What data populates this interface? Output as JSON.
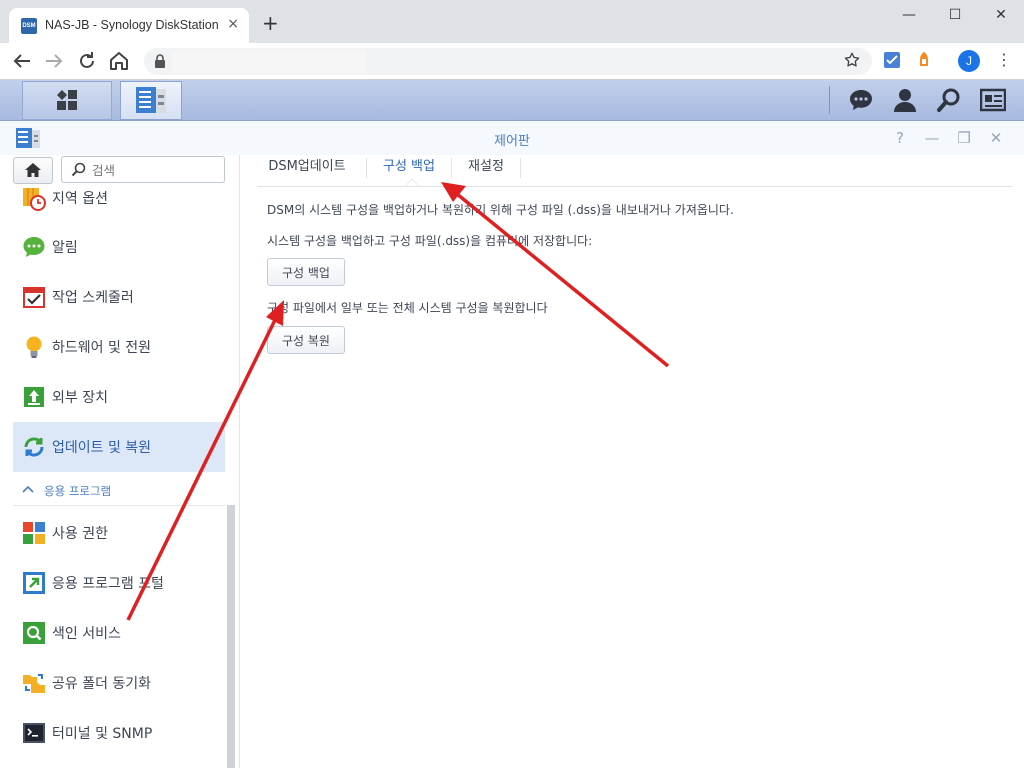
{
  "browser": {
    "tab_favicon": "DSM",
    "tab_title": "NAS-JB - Synology DiskStation",
    "tab_close": "×",
    "new_tab": "+",
    "window_controls": {
      "minimize": "—",
      "maximize": "☐",
      "close": "✕"
    },
    "address_value": "",
    "profile_initial": "J",
    "menu": "⋮"
  },
  "control_panel": {
    "title": "제어판",
    "controls": {
      "help": "?",
      "minimize": "—",
      "restore": "❐",
      "close": "✕"
    }
  },
  "sidebar": {
    "search_placeholder": "검색",
    "items_top": [
      {
        "label": "지역 옵션",
        "icon": "region-options-icon"
      },
      {
        "label": "알림",
        "icon": "notification-icon"
      },
      {
        "label": "작업 스케줄러",
        "icon": "task-scheduler-icon"
      },
      {
        "label": "하드웨어 및 전원",
        "icon": "hardware-power-icon"
      },
      {
        "label": "외부 장치",
        "icon": "external-device-icon"
      },
      {
        "label": "업데이트 및 복원",
        "icon": "update-restore-icon",
        "active": true
      }
    ],
    "section_label": "응용 프로그램",
    "items_apps": [
      {
        "label": "사용 권한",
        "icon": "privileges-icon"
      },
      {
        "label": "응용 프로그램 포털",
        "icon": "application-portal-icon"
      },
      {
        "label": "색인 서비스",
        "icon": "indexing-service-icon"
      },
      {
        "label": "공유 폴더 동기화",
        "icon": "shared-folder-sync-icon"
      },
      {
        "label": "터미널 및 SNMP",
        "icon": "terminal-snmp-icon"
      }
    ]
  },
  "content": {
    "tabs": [
      {
        "label": "DSM업데이트"
      },
      {
        "label": "구성 백업",
        "active": true
      },
      {
        "label": "재설정"
      }
    ],
    "description": "DSM의 시스템 구성을 백업하거나 복원하기 위해 구성 파일 (.dss)을 내보내거나 가져옵니다.",
    "backup_text": "시스템 구성을 백업하고 구성 파일(.dss)을 컴퓨터에 저장합니다:",
    "backup_button": "구성 백업",
    "restore_text": "구성 파일에서 일부 또는 전체 시스템 구성을 복원합니다",
    "restore_button": "구성 복원"
  },
  "colors": {
    "accent": "#2f66c0",
    "taskbar": "#b4c4e6",
    "active_item": "#dce8f8",
    "annotation_arrow": "#e02020"
  }
}
